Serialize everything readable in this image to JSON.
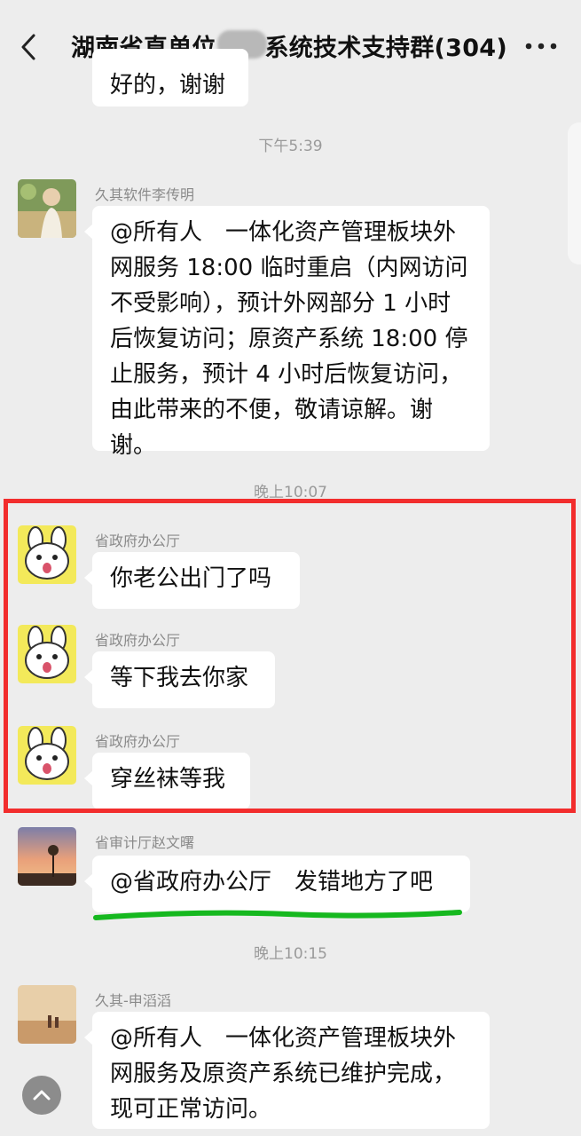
{
  "header": {
    "title": "湖南省直单位　　系统技术支持群(304)"
  },
  "partial_message": {
    "text": "好的，谢谢"
  },
  "timestamps": [
    "下午5:39",
    "晚上10:07",
    "晚上10:15"
  ],
  "messages": [
    {
      "sender": "久其软件李传明",
      "text": "@所有人　一体化资产管理板块外网服务 18:00 临时重启（内网访问不受影响），预计外网部分 1 小时后恢复访问；原资产系统 18:00 停止服务，预计 4 小时后恢复访问，由此带来的不便，敬请谅解。谢谢。"
    },
    {
      "sender": "省政府办公厅",
      "text": "你老公出门了吗"
    },
    {
      "sender": "省政府办公厅",
      "text": "等下我去你家"
    },
    {
      "sender": "省政府办公厅",
      "text": "穿丝袜等我"
    },
    {
      "sender": "省审计厅赵文曙",
      "text": "@省政府办公厅　发错地方了吧"
    },
    {
      "sender": "久其-申滔滔",
      "text": "@所有人　一体化资产管理板块外网服务及原资产系统已维护完成，现可正常访问。"
    }
  ],
  "colors": {
    "background": "#ededed",
    "bubble": "#ffffff",
    "highlight_box": "#f22d2d",
    "underline": "#16b81f"
  }
}
